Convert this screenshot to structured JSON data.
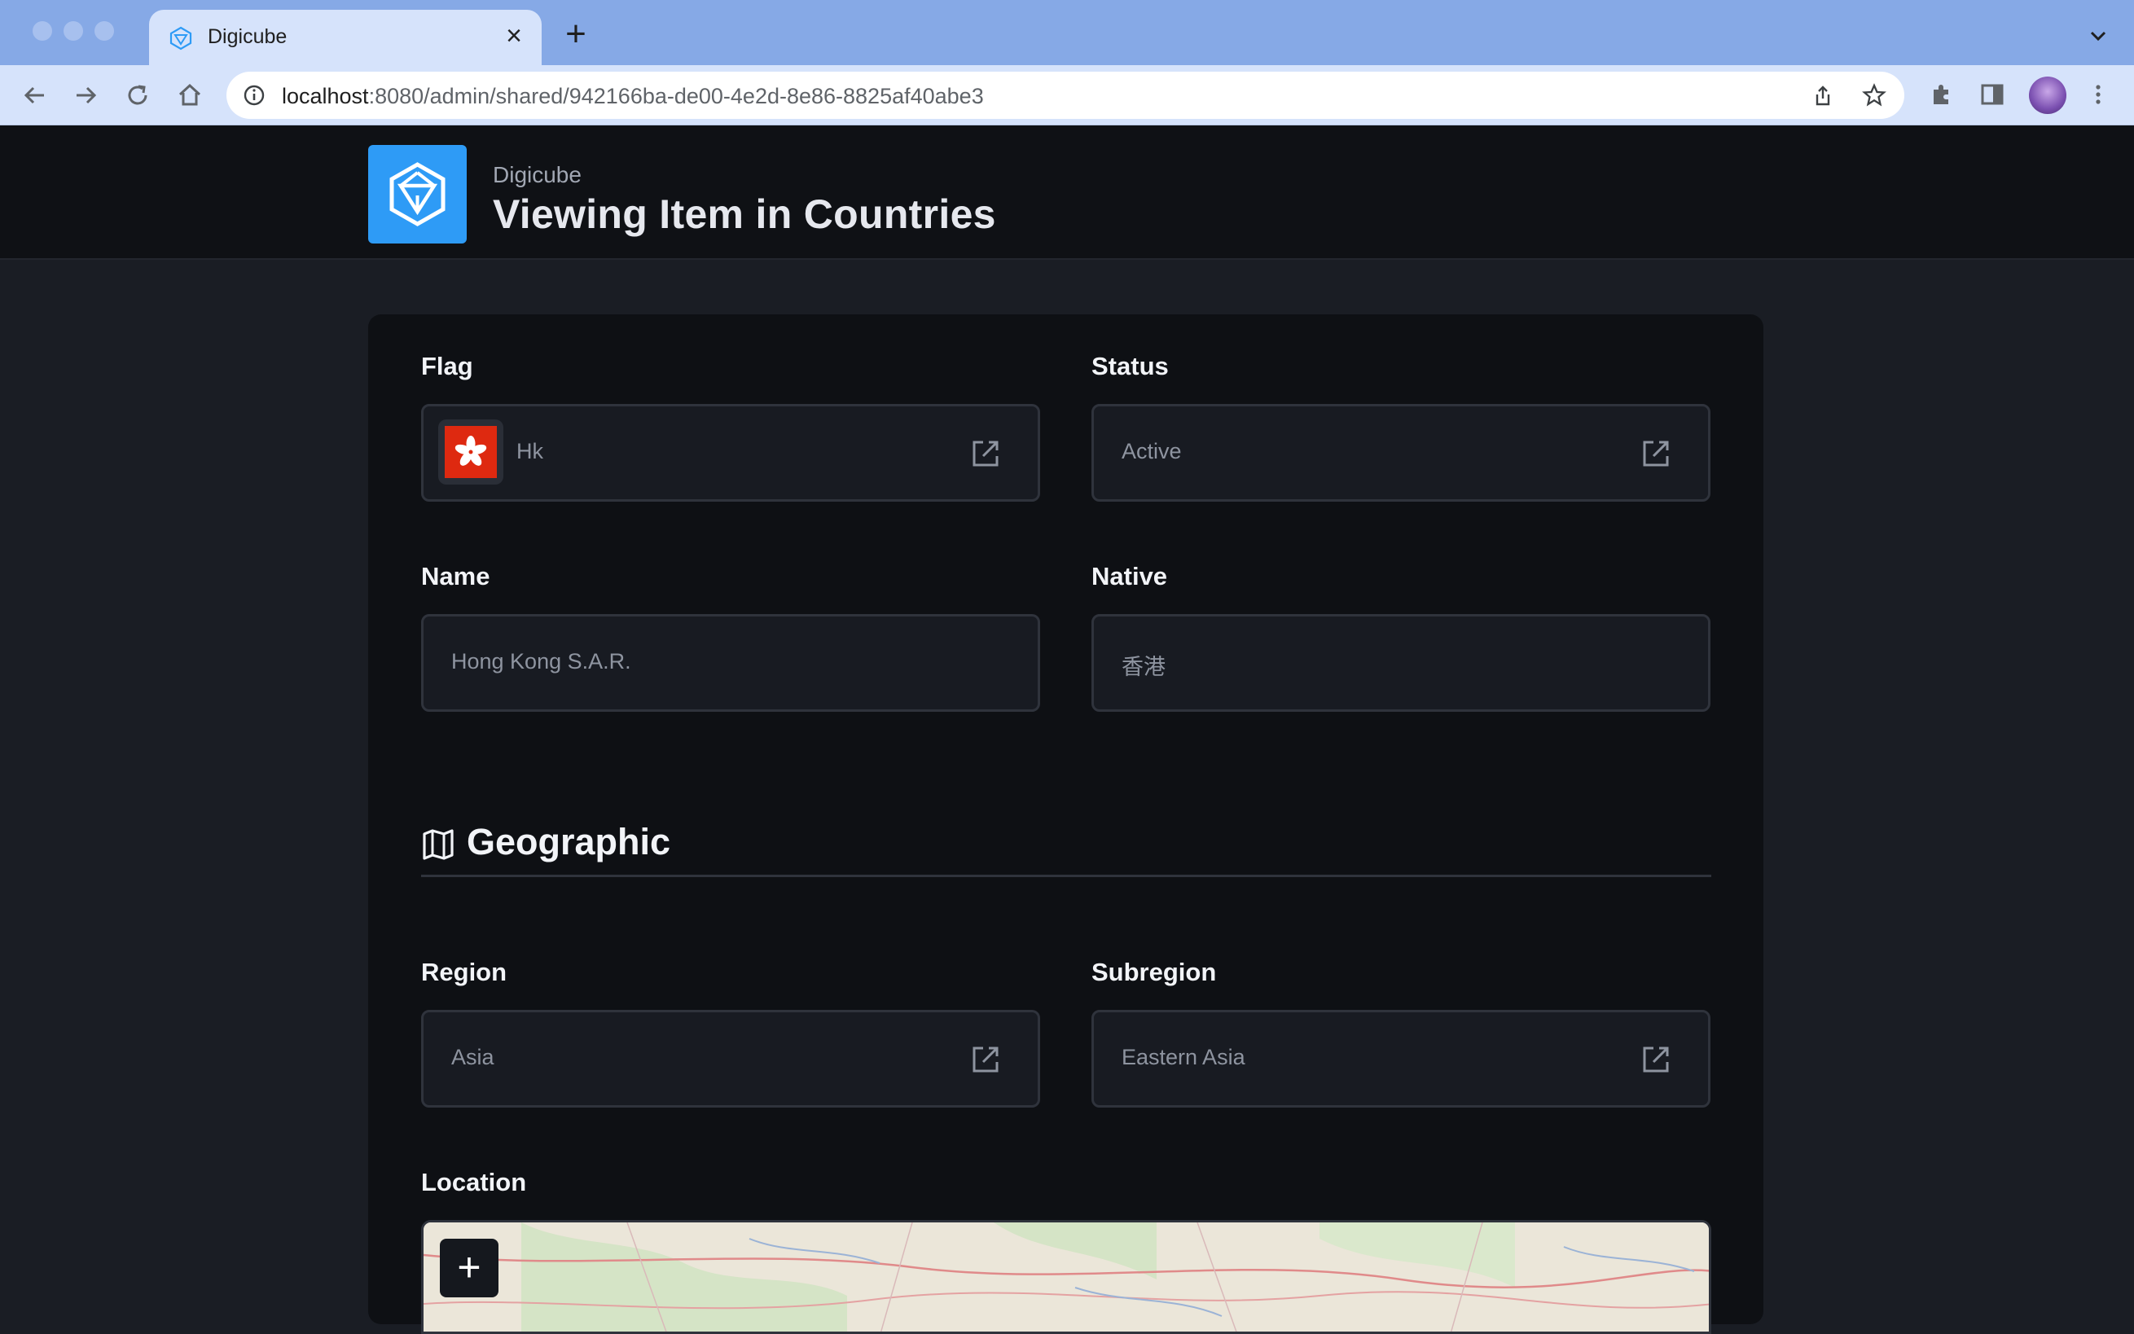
{
  "browser": {
    "tab_title": "Digicube",
    "url_host": "localhost",
    "url_rest": ":8080/admin/shared/942166ba-de00-4e2d-8e86-8825af40abe3"
  },
  "header": {
    "project_name": "Digicube",
    "title": "Viewing Item in Countries"
  },
  "fields": {
    "flag": {
      "label": "Flag",
      "value": "Hk"
    },
    "status": {
      "label": "Status",
      "value": "Active"
    },
    "name": {
      "label": "Name",
      "value": "Hong Kong S.A.R."
    },
    "native": {
      "label": "Native",
      "value": "香港"
    },
    "region": {
      "label": "Region",
      "value": "Asia"
    },
    "subregion": {
      "label": "Subregion",
      "value": "Eastern Asia"
    },
    "location": {
      "label": "Location"
    }
  },
  "sections": {
    "geographic": {
      "title": "Geographic",
      "icon": "map-icon"
    }
  },
  "map": {
    "zoom_in_label": "+"
  },
  "colors": {
    "accent": "#2e9bf6",
    "card_bg": "#0e1014",
    "field_bg": "#181b22",
    "field_border": "#2f333c",
    "flag_red": "#de2910"
  }
}
